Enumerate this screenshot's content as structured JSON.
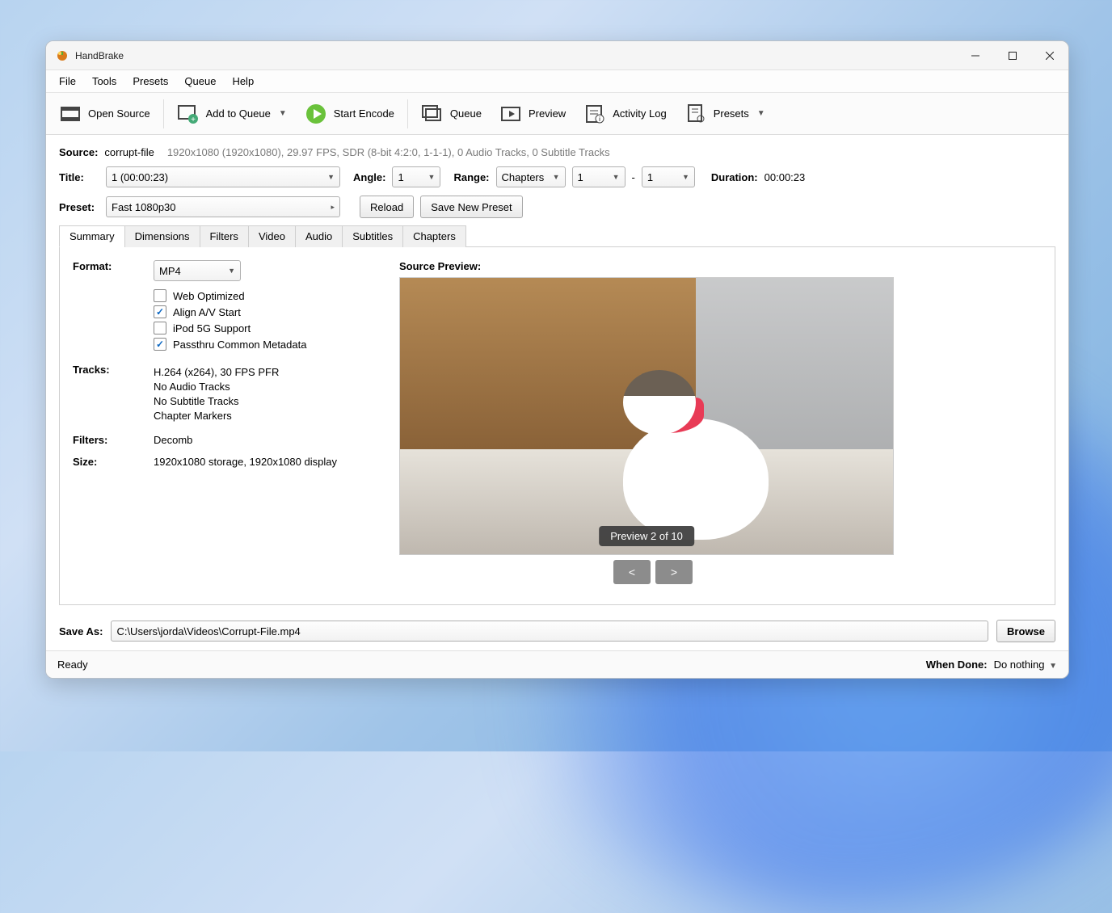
{
  "app": {
    "title": "HandBrake"
  },
  "menubar": [
    "File",
    "Tools",
    "Presets",
    "Queue",
    "Help"
  ],
  "toolbar": {
    "open_source": "Open Source",
    "add_to_queue": "Add to Queue",
    "start_encode": "Start Encode",
    "queue": "Queue",
    "preview": "Preview",
    "activity_log": "Activity Log",
    "presets": "Presets"
  },
  "source": {
    "label": "Source:",
    "name": "corrupt-file",
    "meta": "1920x1080 (1920x1080), 29.97 FPS, SDR (8-bit 4:2:0, 1-1-1), 0 Audio Tracks, 0 Subtitle Tracks"
  },
  "title_row": {
    "title_label": "Title:",
    "title_value": "1  (00:00:23)",
    "angle_label": "Angle:",
    "angle_value": "1",
    "range_label": "Range:",
    "range_mode": "Chapters",
    "range_from": "1",
    "range_sep": "-",
    "range_to": "1",
    "duration_label": "Duration:",
    "duration_value": "00:00:23"
  },
  "preset_row": {
    "label": "Preset:",
    "value": "Fast 1080p30",
    "reload": "Reload",
    "save_new": "Save New Preset"
  },
  "tabs": [
    "Summary",
    "Dimensions",
    "Filters",
    "Video",
    "Audio",
    "Subtitles",
    "Chapters"
  ],
  "summary": {
    "format_label": "Format:",
    "format_value": "MP4",
    "checks": {
      "web_optimized": {
        "label": "Web Optimized",
        "checked": false
      },
      "align_av": {
        "label": "Align A/V Start",
        "checked": true
      },
      "ipod_5g": {
        "label": "iPod 5G Support",
        "checked": false
      },
      "passthru_meta": {
        "label": "Passthru Common Metadata",
        "checked": true
      }
    },
    "tracks_label": "Tracks:",
    "tracks": [
      "H.264 (x264), 30 FPS PFR",
      "No Audio Tracks",
      "No Subtitle Tracks",
      "Chapter Markers"
    ],
    "filters_label": "Filters:",
    "filters_value": "Decomb",
    "size_label": "Size:",
    "size_value": "1920x1080 storage, 1920x1080 display"
  },
  "preview": {
    "label": "Source Preview:",
    "badge": "Preview 2 of 10",
    "prev": "<",
    "next": ">"
  },
  "saveas": {
    "label": "Save As:",
    "path": "C:\\Users\\jorda\\Videos\\Corrupt-File.mp4",
    "browse": "Browse"
  },
  "status": {
    "ready": "Ready",
    "when_done_label": "When Done:",
    "when_done_value": "Do nothing"
  }
}
